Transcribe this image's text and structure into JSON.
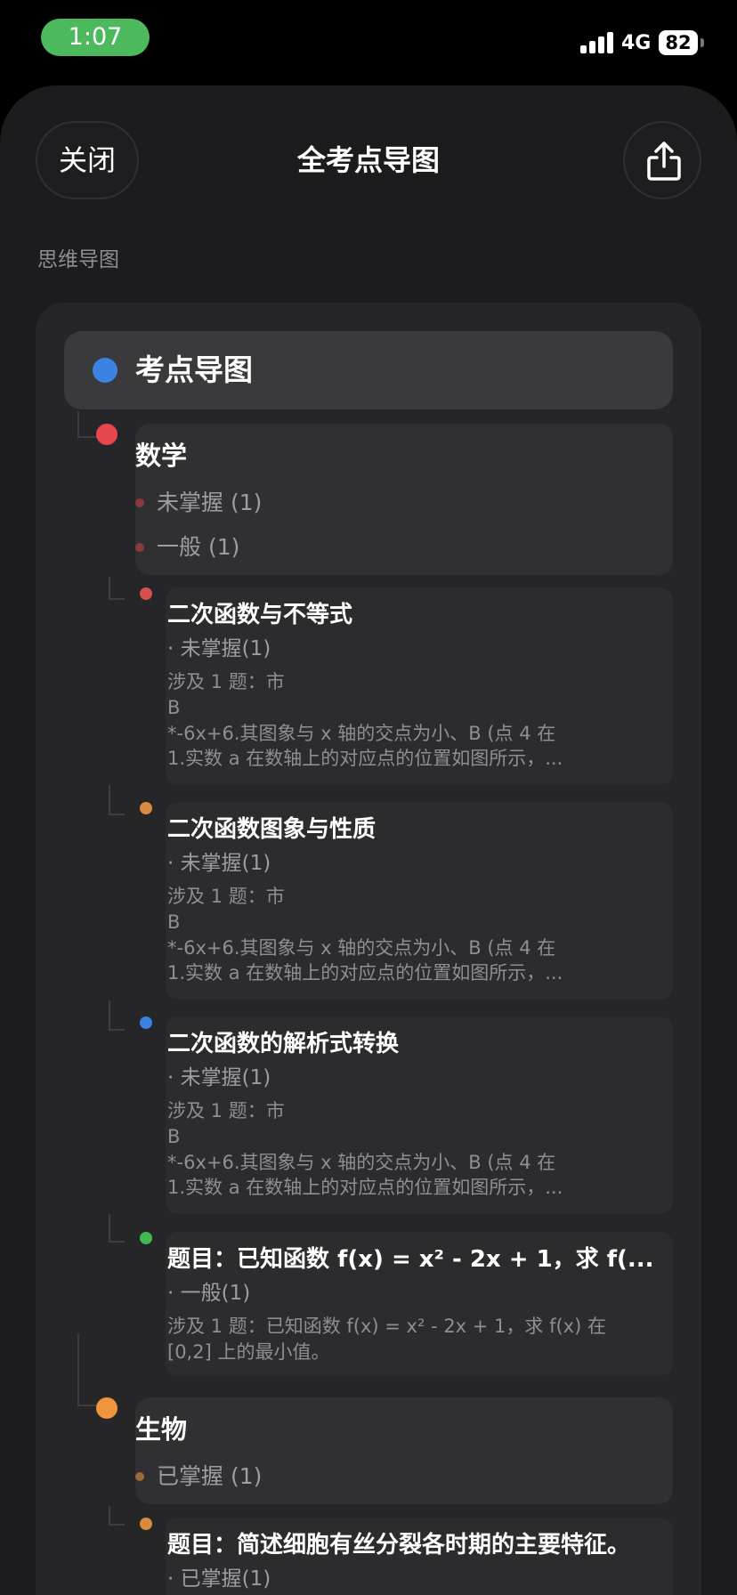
{
  "status_bar": {
    "time": "1:07",
    "network": "4G",
    "battery": "82"
  },
  "header": {
    "close_label": "关闭",
    "title": "全考点导图",
    "share_icon": "share-icon"
  },
  "section_label": "思维导图",
  "root": {
    "label": "考点导图",
    "color": "#3a83e2"
  },
  "subjects": [
    {
      "name": "数学",
      "color": "#e5484d",
      "statuses": [
        "未掌握 (1)",
        "一般 (1)"
      ],
      "topics": [
        {
          "title": "二次函数与不等式",
          "status": "· 未掌握(1)",
          "color": "#d6504f",
          "desc": [
            "涉及 1 题：市",
            "B",
            "*-6x+6.其图象与 x 轴的交点为小、B (点 4 在",
            "1.实数 a 在数轴上的对应点的位置如图所示，..."
          ]
        },
        {
          "title": "二次函数图象与性质",
          "status": "· 未掌握(1)",
          "color": "#d98a3d",
          "desc": [
            "涉及 1 题：市",
            "B",
            "*-6x+6.其图象与 x 轴的交点为小、B (点 4 在",
            "1.实数 a 在数轴上的对应点的位置如图所示，..."
          ]
        },
        {
          "title": "二次函数的解析式转换",
          "status": "· 未掌握(1)",
          "color": "#3a83e2",
          "desc": [
            "涉及 1 题：市",
            "B",
            "*-6x+6.其图象与 x 轴的交点为小、B (点 4 在",
            "1.实数 a 在数轴上的对应点的位置如图所示，..."
          ]
        },
        {
          "title": "题目：已知函数 f(x) = x² - 2x + 1，求 f(...",
          "status": "· 一般(1)",
          "color": "#3fb950",
          "desc": [
            "涉及 1 题：已知函数 f(x) = x² - 2x + 1，求 f(x) 在",
            "[0,2] 上的最小值。"
          ]
        }
      ]
    },
    {
      "name": "生物",
      "color": "#f0953e",
      "statuses": [
        "已掌握 (1)"
      ],
      "topics": [
        {
          "title": "题目：简述细胞有丝分裂各时期的主要特征。",
          "status": "· 已掌握(1)",
          "color": "#d98a3d",
          "desc": []
        }
      ]
    }
  ]
}
